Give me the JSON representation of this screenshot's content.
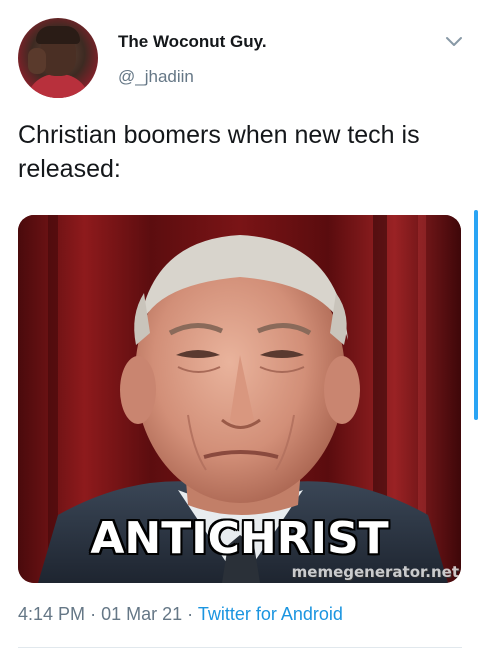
{
  "tweet": {
    "author": {
      "display_name": "The Woconut Guy.",
      "handle": "@_jhadiin",
      "avatar_icon": "profile-avatar"
    },
    "menu_icon": "chevron-down-icon",
    "text": "Christian boomers when new tech is released:",
    "media": {
      "caption": "ANTICHRIST",
      "watermark": "memegenerator.net"
    },
    "meta": {
      "time": "4:14 PM",
      "separator": "·",
      "date": "01 Mar 21",
      "source": "Twitter for Android"
    }
  },
  "colors": {
    "text": "#14171a",
    "secondary": "#657786",
    "link": "#1b95e0",
    "scrollbar": "#2aa4f4"
  }
}
